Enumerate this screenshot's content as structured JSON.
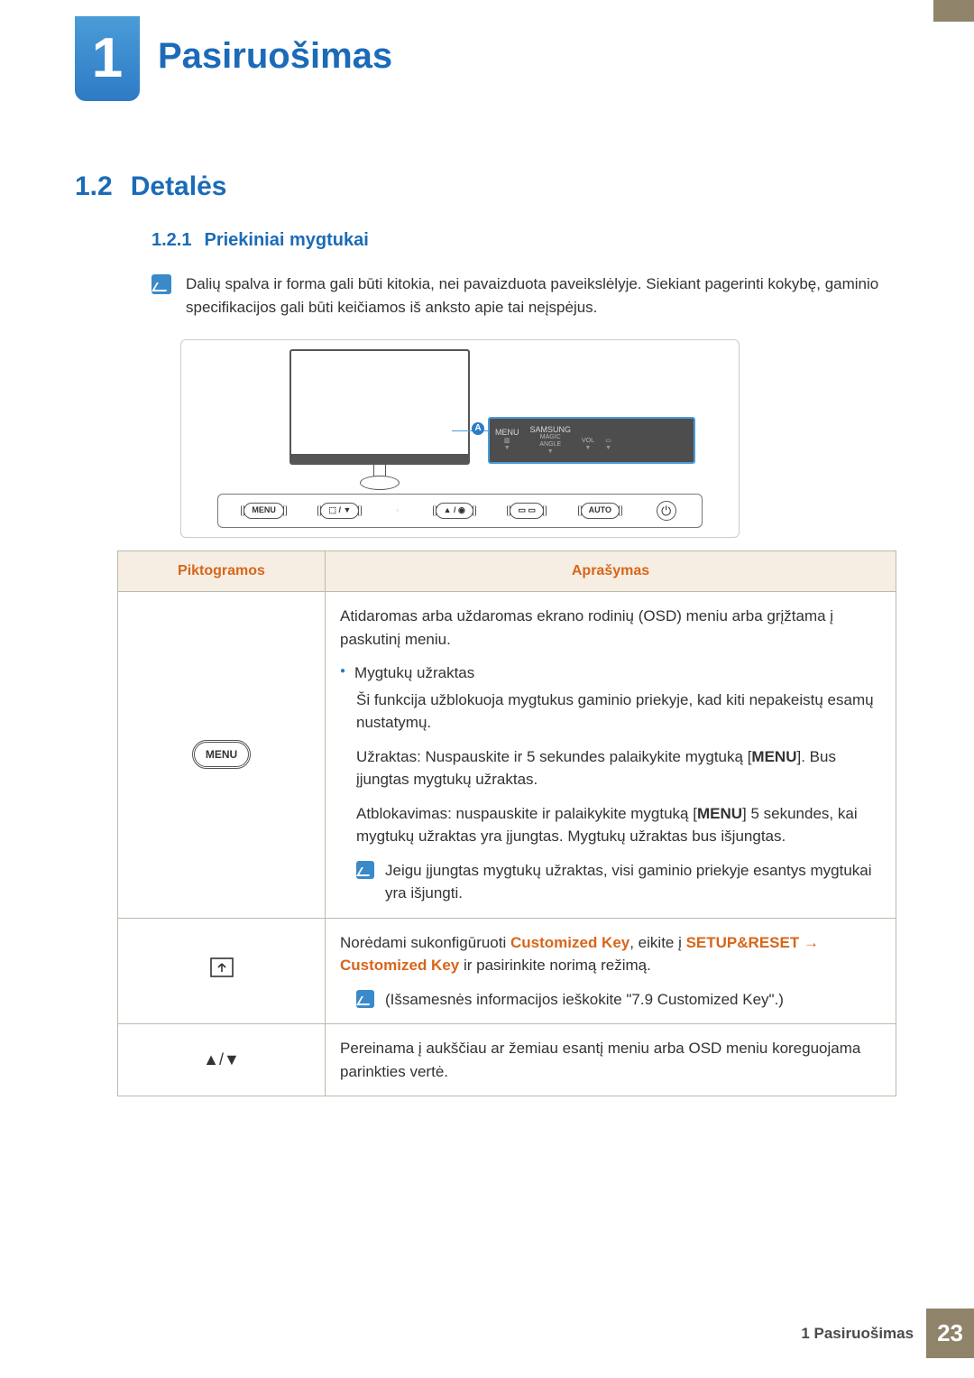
{
  "chapter": {
    "number": "1",
    "title": "Pasiruošimas"
  },
  "section": {
    "number": "1.2",
    "title": "Detalės"
  },
  "subsection": {
    "number": "1.2.1",
    "title": "Priekiniai mygtukai"
  },
  "note": "Dalių spalva ir forma gali būti kitokia, nei pavaizduota paveikslėlyje. Siekiant pagerinti kokybę, gaminio specifikacijos gali būti keičiamos iš anksto apie tai neįspėjus.",
  "diagram": {
    "callout_marker": "A",
    "callout_labels": {
      "menu": "MENU",
      "brand": "SAMSUNG",
      "magic": "MAGIC\nANGLE",
      "vol": "VOL",
      "bars_icon": "bars-icon",
      "rect_icon": "rect-icon"
    },
    "button_row": {
      "menu": "MENU",
      "mid1": "⬚ / ▼",
      "mid2": "▲ / ◉",
      "mid3": "▭ ▭",
      "auto": "AUTO"
    }
  },
  "table": {
    "headers": {
      "icons": "Piktogramos",
      "desc": "Aprašymas"
    },
    "rows": [
      {
        "icon_label": "MENU",
        "p1": "Atidaromas arba uždaromas ekrano rodinių (OSD) meniu arba grįžtama į paskutinį meniu.",
        "bullet": "Mygtukų užraktas",
        "p2": "Ši funkcija užblokuoja mygtukus gaminio priekyje, kad kiti nepakeistų esamų nustatymų.",
        "p3_pre": "Užraktas: Nuspauskite ir 5 sekundes palaikykite mygtuką [",
        "p3_btn": "MENU",
        "p3_post": "]. Bus įjungtas mygtukų užraktas.",
        "p4_pre": "Atblokavimas: nuspauskite ir palaikykite mygtuką [",
        "p4_btn": "MENU",
        "p4_post": "] 5 sekundes, kai mygtukų užraktas yra įjungtas. Mygtukų užraktas bus išjungtas.",
        "nested_note": "Jeigu įjungtas mygtukų užraktas, visi gaminio priekyje esantys mygtukai yra išjungti."
      },
      {
        "p1_pre": "Norėdami sukonfigūruoti ",
        "p1_k1": "Customized Key",
        "p1_mid": ", eikite į ",
        "p1_k2": "SETUP&RESET",
        "p2_k": "Customized Key",
        "p2_post": " ir pasirinkite norimą režimą.",
        "nested_note": "(Išsamesnės informacijos ieškokite \"7.9 Customized Key\".)"
      },
      {
        "icon_glyph": "▲/▼",
        "p1": "Pereinama į aukščiau ar žemiau esantį meniu arba OSD meniu koreguojama parinkties vertė."
      }
    ]
  },
  "footer": {
    "text": "1 Pasiruošimas",
    "page": "23"
  }
}
